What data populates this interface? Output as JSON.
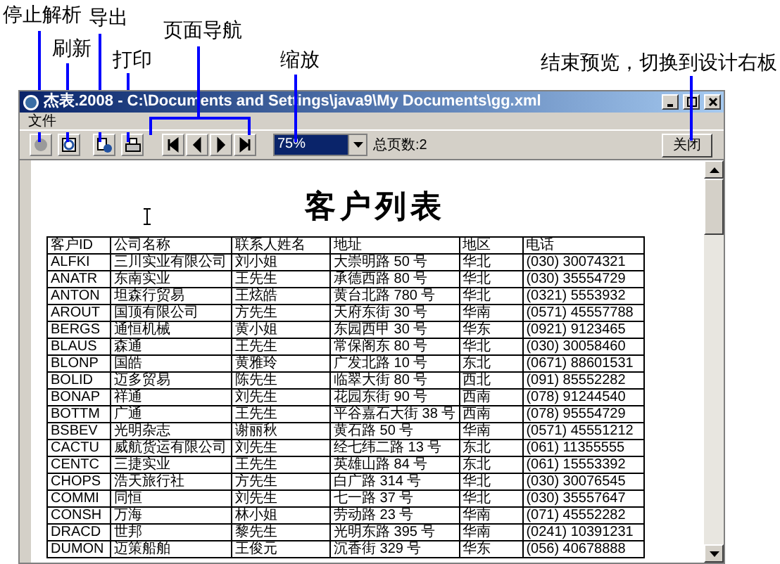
{
  "annotations": [
    {
      "label": "停止解析"
    },
    {
      "label": "刷新"
    },
    {
      "label": "导出"
    },
    {
      "label": "打印"
    },
    {
      "label": "页面导航"
    },
    {
      "label": "缩放"
    },
    {
      "label": "结束预览，切换到设计右板"
    }
  ],
  "window": {
    "title": "杰表.2008 - C:\\Documents and Settings\\java9\\My Documents\\gg.xml"
  },
  "menu": [
    "文件"
  ],
  "toolbar": {
    "zoom": "75%",
    "page_count": "总页数:2",
    "close_button": "关闭"
  },
  "document": {
    "title": "客户列表",
    "columns": [
      "客户ID",
      "公司名称",
      "联系人姓名",
      "地址",
      "地区",
      "电话"
    ],
    "rows": [
      [
        "ALFKI",
        "三川实业有限公司",
        "刘小姐",
        "大崇明路 50 号",
        "华北",
        "(030) 30074321"
      ],
      [
        "ANATR",
        "东南实业",
        "王先生",
        "承德西路 80 号",
        "华北",
        "(030) 35554729"
      ],
      [
        "ANTON",
        "坦森行贸易",
        "王炫皓",
        "黄台北路 780 号",
        "华北",
        "(0321) 5553932"
      ],
      [
        "AROUT",
        "国顶有限公司",
        "方先生",
        "天府东街 30 号",
        "华南",
        "(0571) 45557788"
      ],
      [
        "BERGS",
        "通恒机械",
        "黄小姐",
        "东园西甲 30 号",
        "华东",
        "(0921) 9123465"
      ],
      [
        "BLAUS",
        "森通",
        "王先生",
        "常保阁东 80 号",
        "华北",
        "(030) 30058460"
      ],
      [
        "BLONP",
        "国皓",
        "黄雅玲",
        "广发北路 10 号",
        "东北",
        "(0671) 88601531"
      ],
      [
        "BOLID",
        "迈多贸易",
        "陈先生",
        "临翠大街 80 号",
        "西北",
        "(091) 85552282"
      ],
      [
        "BONAP",
        "祥通",
        "刘先生",
        "花园东街 90 号",
        "西南",
        "(078) 91244540"
      ],
      [
        "BOTTM",
        "广通",
        "王先生",
        "平谷嘉石大街 38 号",
        "西南",
        "(078) 95554729"
      ],
      [
        "BSBEV",
        "光明杂志",
        "谢丽秋",
        "黄石路 50 号",
        "华南",
        "(0571) 45551212"
      ],
      [
        "CACTU",
        "威航货运有限公司",
        "刘先生",
        "经七纬二路 13 号",
        "东北",
        "(061) 11355555"
      ],
      [
        "CENTC",
        "三捷实业",
        "王先生",
        "英雄山路 84 号",
        "东北",
        "(061) 15553392"
      ],
      [
        "CHOPS",
        "浩天旅行社",
        "方先生",
        "白广路 314 号",
        "华北",
        "(030) 30076545"
      ],
      [
        "COMMI",
        "同恒",
        "刘先生",
        "七一路 37 号",
        "华北",
        "(030) 35557647"
      ],
      [
        "CONSH",
        "万海",
        "林小姐",
        "劳动路 23 号",
        "华南",
        "(071) 45552282"
      ],
      [
        "DRACD",
        "世邦",
        "黎先生",
        "光明东路 395 号",
        "华南",
        "(0241) 10391231"
      ],
      [
        "DUMON",
        "迈策船舶",
        "王俊元",
        "沉香街 329 号",
        "华东",
        "(056) 40678888"
      ]
    ]
  }
}
